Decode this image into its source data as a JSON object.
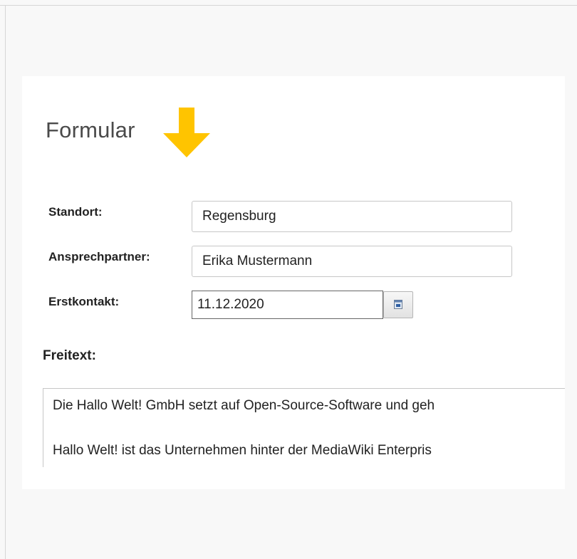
{
  "form": {
    "title": "Formular",
    "fields": {
      "standort": {
        "label": "Standort:",
        "value": "Regensburg"
      },
      "ansprechpartner": {
        "label": "Ansprechpartner:",
        "value": "Erika Mustermann"
      },
      "erstkontakt": {
        "label": "Erstkontakt:",
        "value": "11.12.2020"
      }
    },
    "freitext": {
      "label": "Freitext:",
      "lines": [
        "Die Hallo Welt! GmbH setzt auf Open-Source-Software und geh",
        "Hallo Welt! ist das Unternehmen hinter der MediaWiki Enterpris"
      ]
    }
  },
  "icons": {
    "arrow": "arrow-down-icon",
    "calendar": "calendar-icon"
  },
  "colors": {
    "arrow": "#ffc400",
    "page_background": "#f8f8f8",
    "card_background": "#ffffff"
  }
}
